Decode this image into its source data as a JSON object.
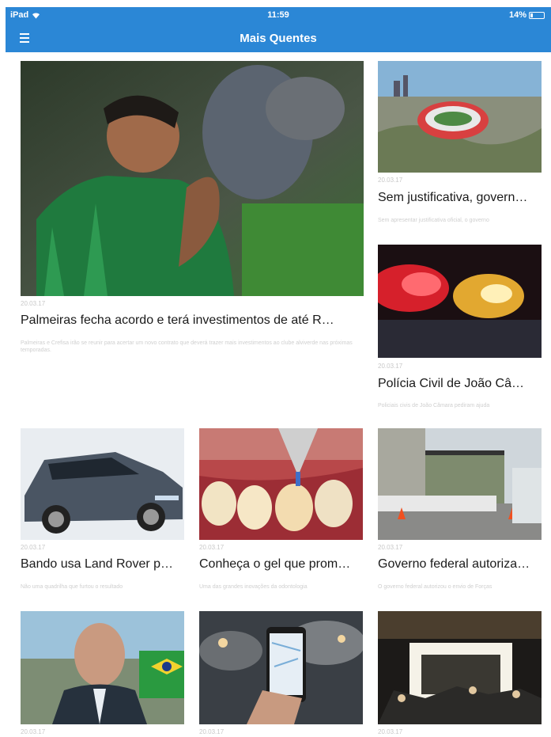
{
  "status_bar": {
    "device": "iPad",
    "time": "11:59",
    "battery": "14%",
    "battery_level": 0.14
  },
  "nav": {
    "title": "Mais Quentes",
    "menu_icon": "hamburger-menu-icon"
  },
  "articles": [
    {
      "date": "20.03.17",
      "title": "Palmeiras fecha acordo e terá investimentos de até R…",
      "summary": "Palmeiras e Crefisa irão se reunir para acertar um novo contrato que deverá trazer mais investimentos ao clube alviverde nas próximas temporadas."
    },
    {
      "date": "20.03.17",
      "title": "Sem justificativa, govern…",
      "summary": "Sem apresentar justificativa oficial, o governo"
    },
    {
      "date": "20.03.17",
      "title": "Polícia Civil de João Câ…",
      "summary": "Policiais civis de João Câmara pediram ajuda"
    },
    {
      "date": "20.03.17",
      "title": "Bando usa Land Rover p…",
      "summary": "Não uma quadrilha que furtou o resultado"
    },
    {
      "date": "20.03.17",
      "title": "Conheça o gel que prom…",
      "summary": "Uma das grandes inovações da odontologia"
    },
    {
      "date": "20.03.17",
      "title": "Governo federal autoriza…",
      "summary": "O governo federal autorizou o envio de Forças"
    },
    {
      "date": "20.03.17",
      "title": "",
      "summary": ""
    },
    {
      "date": "20.03.17",
      "title": "",
      "summary": ""
    },
    {
      "date": "20.03.17",
      "title": "",
      "summary": ""
    }
  ]
}
